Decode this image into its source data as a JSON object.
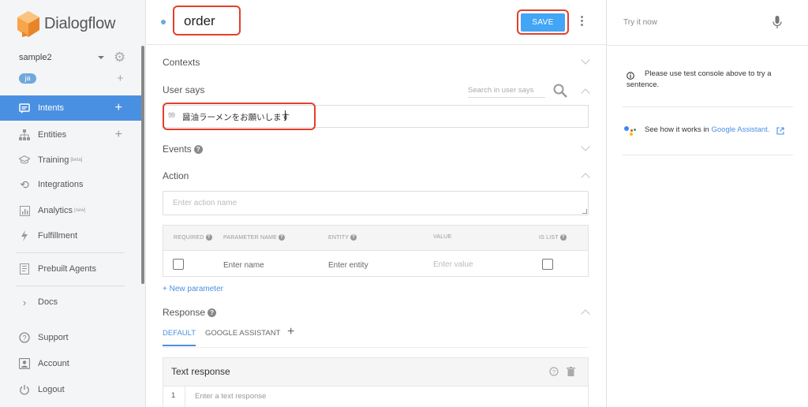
{
  "app": {
    "name": "Dialogflow"
  },
  "agent": {
    "name": "sample2",
    "language_badge": "ja"
  },
  "sidebar": {
    "items": [
      {
        "label": "Intents",
        "badge": ""
      },
      {
        "label": "Entities",
        "badge": ""
      },
      {
        "label": "Training",
        "badge": "[beta]"
      },
      {
        "label": "Integrations",
        "badge": ""
      },
      {
        "label": "Analytics",
        "badge": "[new]"
      },
      {
        "label": "Fulfillment",
        "badge": ""
      },
      {
        "label": "Prebuilt Agents",
        "badge": ""
      },
      {
        "label": "Docs",
        "badge": ""
      },
      {
        "label": "Support",
        "badge": ""
      },
      {
        "label": "Account",
        "badge": ""
      },
      {
        "label": "Logout",
        "badge": ""
      }
    ]
  },
  "intent": {
    "name": "order",
    "save_label": "SAVE"
  },
  "sections": {
    "contexts": "Contexts",
    "user_says": "User says",
    "events": "Events",
    "action": "Action",
    "response": "Response"
  },
  "user_says": {
    "search_placeholder": "Search in user says",
    "quote_mark": "99",
    "phrase": "醤油ラーメンをお願いします"
  },
  "action": {
    "placeholder": "Enter action name",
    "columns": [
      "REQUIRED",
      "PARAMETER NAME",
      "ENTITY",
      "VALUE",
      "IS LIST"
    ],
    "row": {
      "name_placeholder": "Enter name",
      "entity_placeholder": "Enter entity",
      "value_placeholder": "Enter value"
    },
    "new_parameter": "+ New parameter"
  },
  "response": {
    "tabs": [
      "DEFAULT",
      "GOOGLE ASSISTANT"
    ],
    "add_tab": "+",
    "card_title": "Text response",
    "row_number": "1",
    "text_placeholder": "Enter a text response"
  },
  "console": {
    "try_placeholder": "Try it now",
    "info_text": "Please use test console above to try a sentence.",
    "assistant_prefix": "See how it works in ",
    "assistant_link": "Google Assistant."
  },
  "colors": {
    "accent": "#4a90e2",
    "highlight": "#e2402b",
    "save_button": "#42a5f5"
  }
}
